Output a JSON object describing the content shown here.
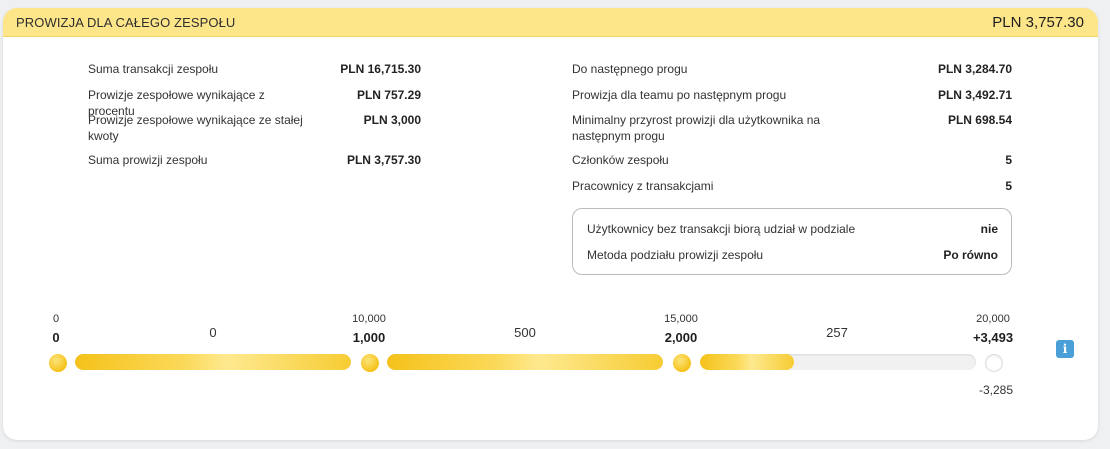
{
  "header": {
    "title": "PROWIZJA DLA CAŁEGO ZESPOŁU",
    "total": "PLN 3,757.30"
  },
  "left": [
    {
      "label": "Suma transakcji zespołu",
      "value": "PLN 16,715.30"
    },
    {
      "label": "Prowizje zespołowe wynikające z procentu",
      "value": "PLN 757.29"
    },
    {
      "label": "Prowizje zespołowe wynikające ze stałej kwoty",
      "value": "PLN 3,000"
    },
    {
      "label": "Suma prowizji zespołu",
      "value": "PLN 3,757.30"
    }
  ],
  "right": [
    {
      "label": "Do następnego progu",
      "value": "PLN 3,284.70"
    },
    {
      "label": "Prowizja dla teamu po następnym progu",
      "value": "PLN 3,492.71"
    },
    {
      "label": "Minimalny przyrost prowizji dla użytkownika na następnym progu",
      "value": "PLN 698.54"
    },
    {
      "label": "Członków zespołu",
      "value": "5"
    },
    {
      "label": "Pracownicy z transakcjami",
      "value": "5"
    }
  ],
  "box": [
    {
      "label": "Użytkownicy bez transakcji biorą udział w podziale",
      "value": "nie"
    },
    {
      "label": "Metoda podziału prowizji zespołu",
      "value": "Po równo"
    }
  ],
  "progress": {
    "thresholds": [
      {
        "amount": "0",
        "commission": "0"
      },
      {
        "amount": "10,000",
        "commission": "1,000"
      },
      {
        "amount": "15,000",
        "commission": "2,000"
      },
      {
        "amount": "20,000",
        "commission": "+3,493"
      }
    ],
    "segments": [
      {
        "label": "0",
        "fill": 1.0
      },
      {
        "label": "500",
        "fill": 1.0
      },
      {
        "label": "257",
        "fill": 0.34
      }
    ],
    "remaining": "-3,285",
    "accent": "#f5c21a"
  },
  "icons": {
    "info": "i"
  }
}
